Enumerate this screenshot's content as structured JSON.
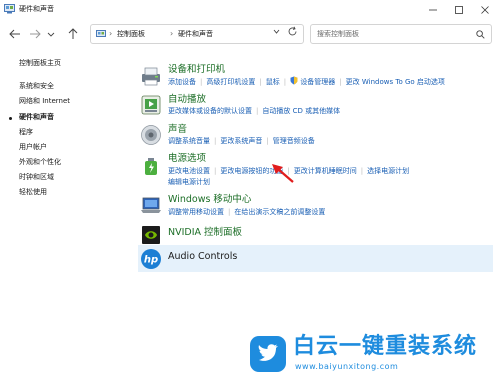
{
  "window": {
    "title": "硬件和声音"
  },
  "navbar": {
    "breadcrumb": [
      "控制面板",
      "硬件和声音"
    ],
    "search_placeholder": "搜索控制面板"
  },
  "sidebar": {
    "items": [
      {
        "label": "控制面板主页"
      },
      {
        "label": "系统和安全"
      },
      {
        "label": "网络和 Internet"
      },
      {
        "label": "硬件和声音"
      },
      {
        "label": "程序"
      },
      {
        "label": "用户帐户"
      },
      {
        "label": "外观和个性化"
      },
      {
        "label": "时钟和区域"
      },
      {
        "label": "轻松使用"
      }
    ]
  },
  "categories": [
    {
      "title": "设备和打印机",
      "icon": "printer-icon",
      "links": [
        {
          "label": "添加设备"
        },
        {
          "label": "高级打印机设置"
        },
        {
          "label": "鼠标"
        },
        {
          "label": "设备管理器"
        },
        {
          "label": "更改 Windows To Go 启动选项"
        }
      ]
    },
    {
      "title": "自动播放",
      "icon": "autoplay-icon",
      "links": [
        {
          "label": "更改媒体或设备的默认设置"
        },
        {
          "label": "自动播放 CD 或其他媒体"
        }
      ]
    },
    {
      "title": "声音",
      "icon": "speaker-icon",
      "links": [
        {
          "label": "调整系统音量"
        },
        {
          "label": "更改系统声音"
        },
        {
          "label": "管理音频设备"
        }
      ]
    },
    {
      "title": "电源选项",
      "icon": "power-options-icon",
      "links": [
        {
          "label": "更改电池设置"
        },
        {
          "label": "更改电源按钮的功能"
        },
        {
          "label": "更改计算机睡眠时间"
        },
        {
          "label": "选择电源计划"
        },
        {
          "label": "编辑电源计划"
        }
      ]
    },
    {
      "title": "Windows 移动中心",
      "icon": "mobility-center-icon",
      "links": [
        {
          "label": "调整常用移动设置"
        },
        {
          "label": "在给出演示文稿之前调整设置"
        }
      ]
    },
    {
      "title": "NVIDIA 控制面板",
      "icon": "nvidia-icon",
      "links": []
    },
    {
      "title": "Audio Controls",
      "icon": "hp-icon",
      "links": []
    }
  ],
  "watermark": {
    "title": "白云一键重装系统",
    "url": "www.baiyunxitong.com"
  },
  "colors": {
    "category_title": "#1c6e27",
    "link": "#1a5fb4",
    "highlight": "#e5f1fb",
    "arrow": "#e11d1d",
    "watermark": "#1e8cde"
  }
}
